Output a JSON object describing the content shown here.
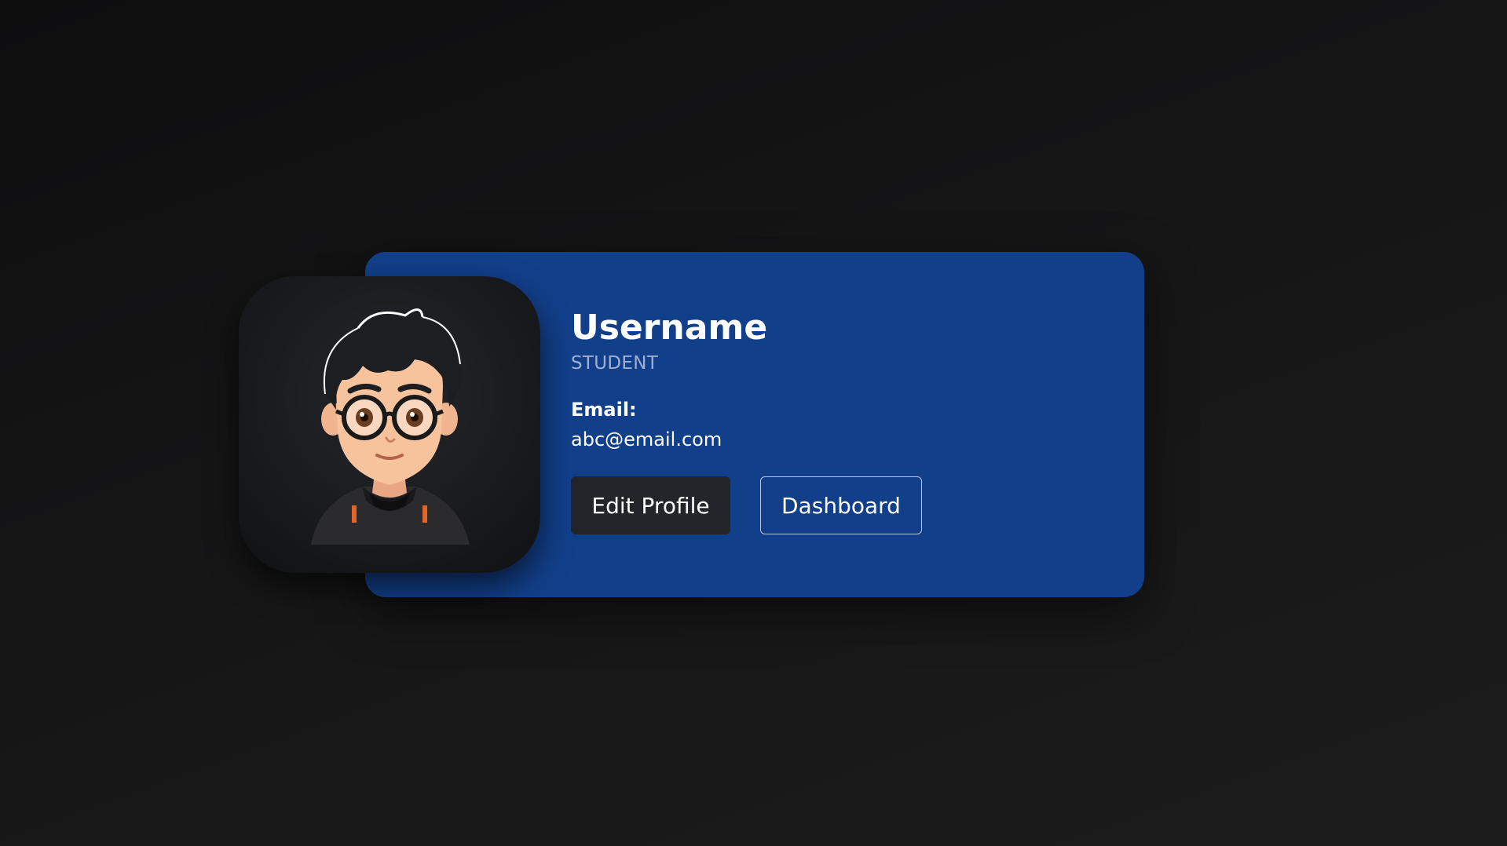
{
  "profile": {
    "username": "Username",
    "role": "STUDENT",
    "email_label": "Email:",
    "email_value": "abc@email.com",
    "avatar_icon": "cartoon-boy-avatar"
  },
  "actions": {
    "edit_label": "Edit Profile",
    "dashboard_label": "Dashboard"
  },
  "colors": {
    "background": "#151516",
    "card": "#123f8a",
    "primary_button": "#24252b",
    "role_text": "#9fb0d3"
  }
}
